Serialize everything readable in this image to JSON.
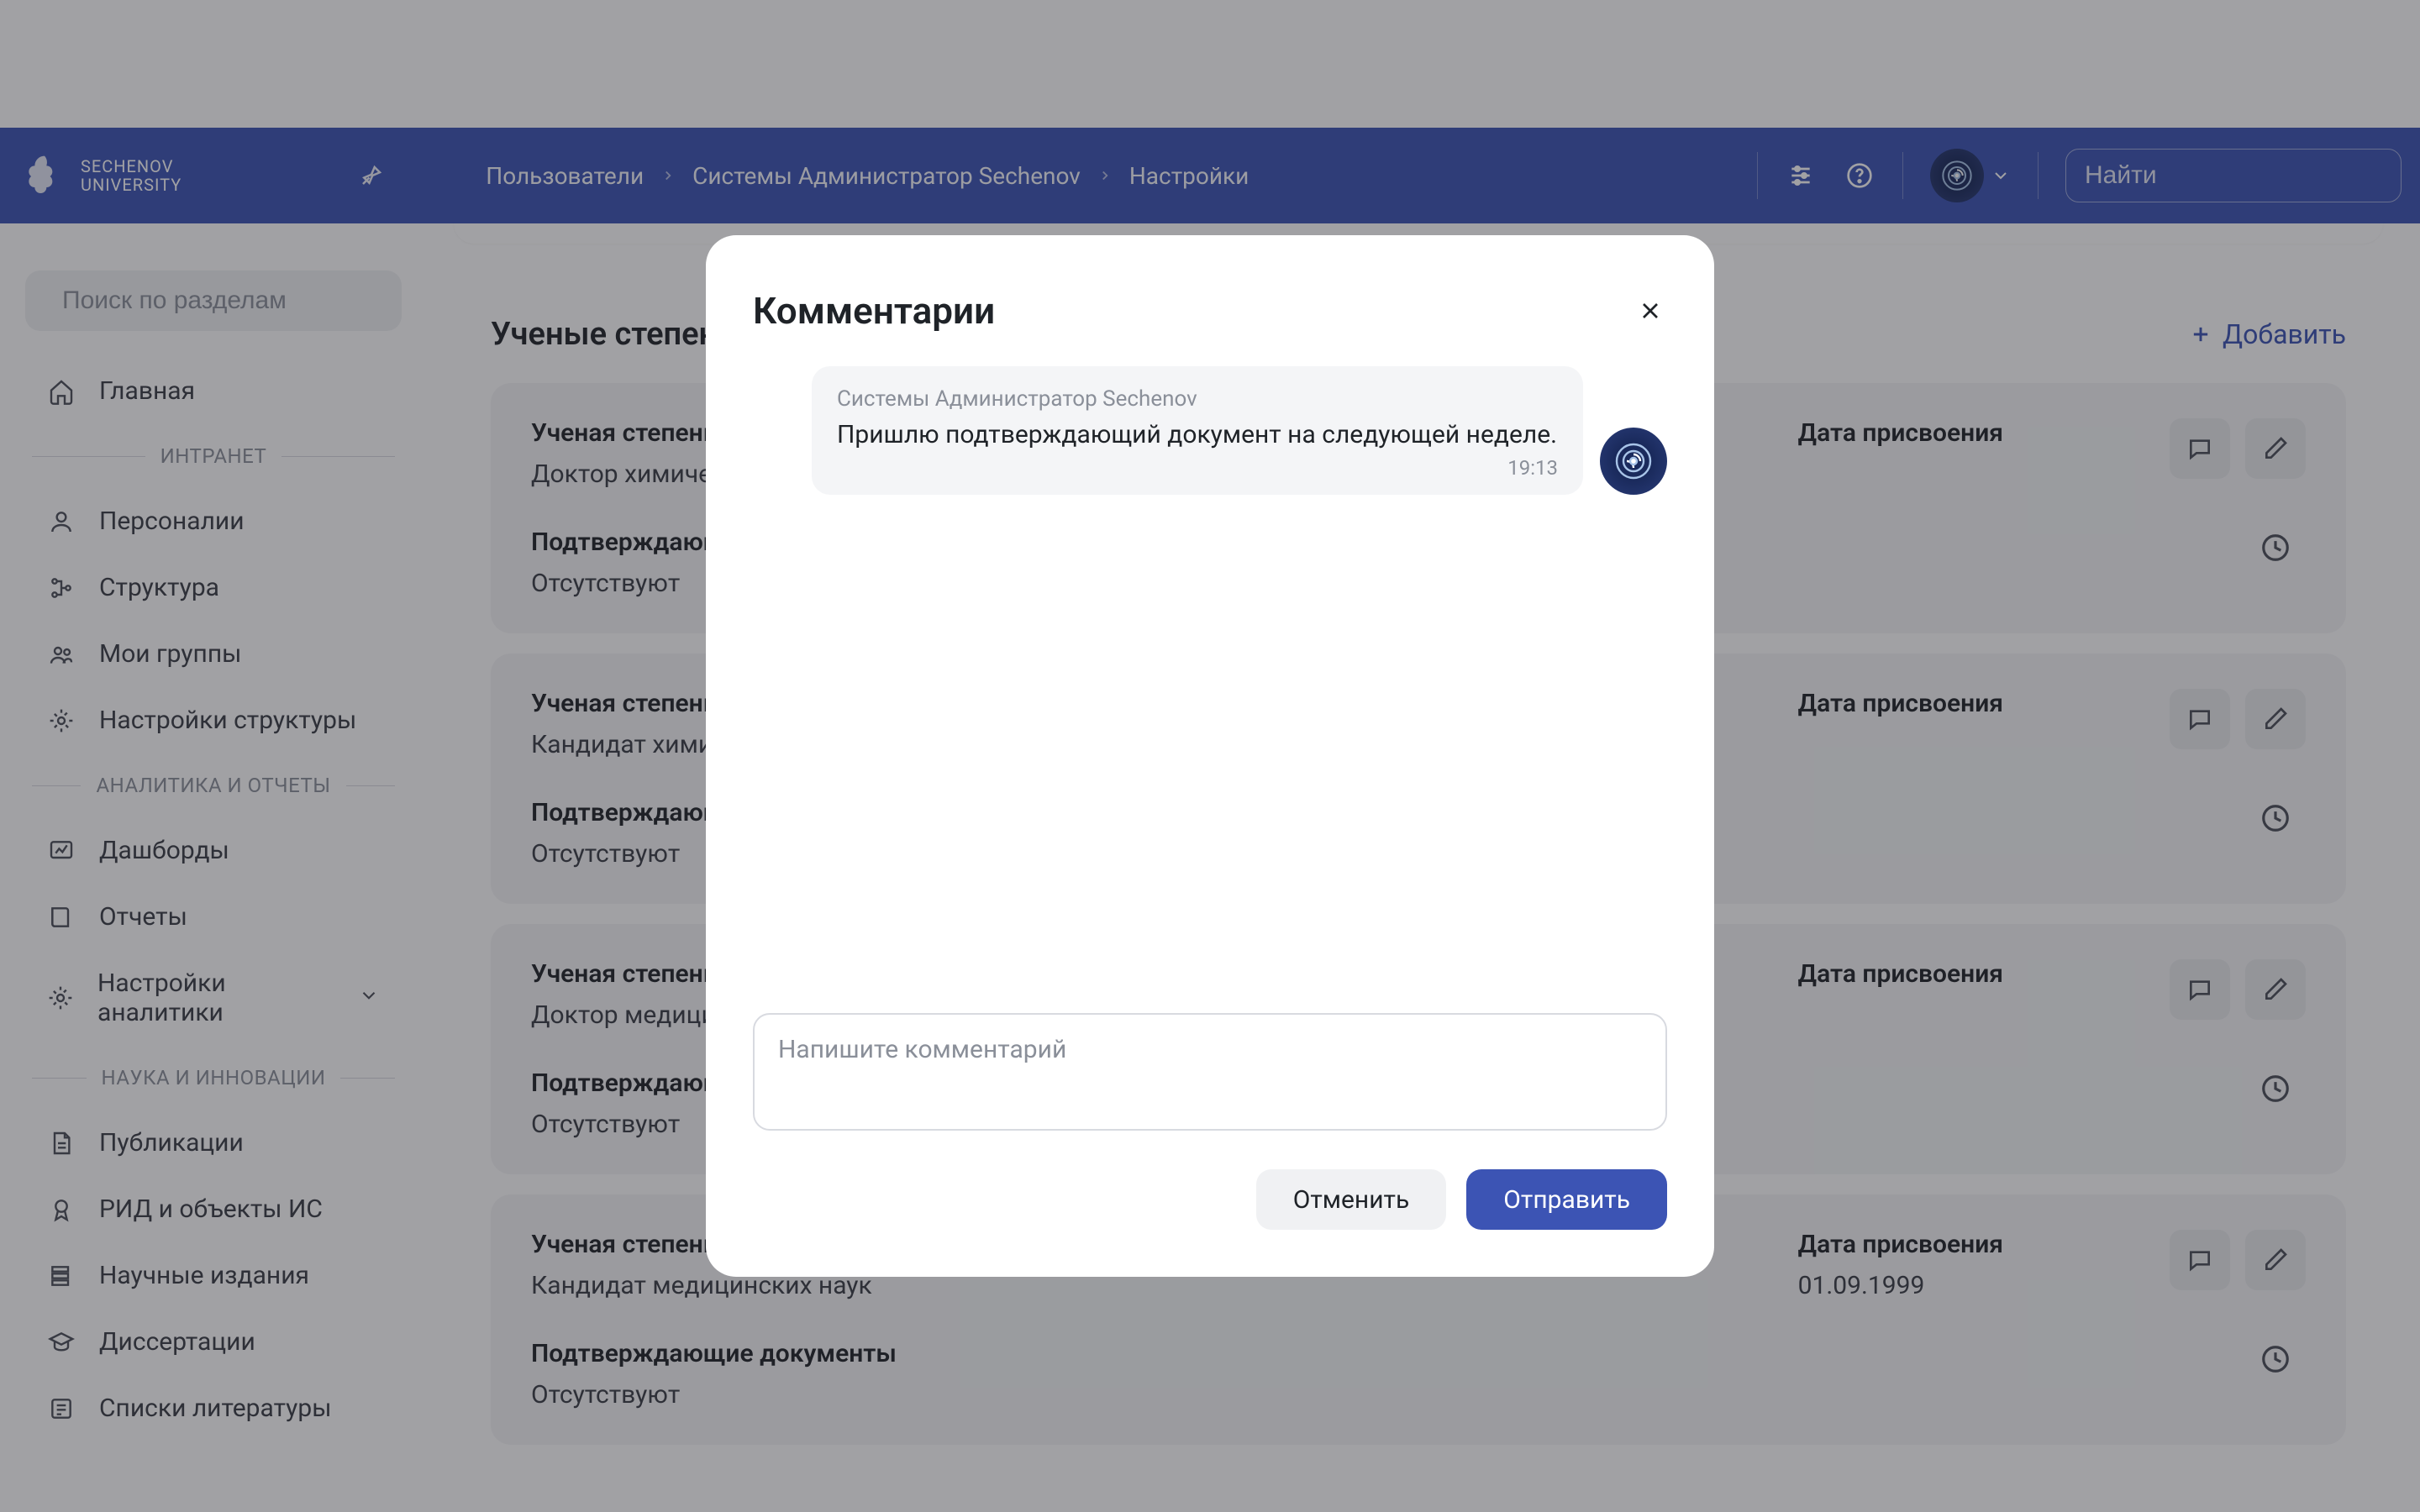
{
  "header": {
    "brand_line1": "SECHENOV",
    "brand_line2": "UNIVERSITY",
    "breadcrumb": [
      "Пользователи",
      "Системы Администратор Sechenov",
      "Настройки"
    ],
    "search_placeholder": "Найти"
  },
  "sidebar": {
    "search_placeholder": "Поиск по разделам",
    "top": [
      {
        "icon": "home",
        "label": "Главная"
      }
    ],
    "sections": [
      {
        "title": "ИНТРАНЕТ",
        "items": [
          {
            "icon": "user",
            "label": "Персоналии"
          },
          {
            "icon": "tree",
            "label": "Структура"
          },
          {
            "icon": "users",
            "label": "Мои группы"
          },
          {
            "icon": "gear",
            "label": "Настройки структуры"
          }
        ]
      },
      {
        "title": "АНАЛИТИКА И ОТЧЕТЫ",
        "items": [
          {
            "icon": "dashboard",
            "label": "Дашборды"
          },
          {
            "icon": "book",
            "label": "Отчеты"
          },
          {
            "icon": "gear",
            "label": "Настройки аналитики",
            "has_caret": true
          }
        ]
      },
      {
        "title": "НАУКА И ИННОВАЦИИ",
        "items": [
          {
            "icon": "doc",
            "label": "Публикации"
          },
          {
            "icon": "badge",
            "label": "РИД и объекты ИС"
          },
          {
            "icon": "layers",
            "label": "Научные издания"
          },
          {
            "icon": "grad",
            "label": "Диссертации"
          },
          {
            "icon": "list",
            "label": "Списки литературы"
          }
        ]
      }
    ]
  },
  "panel": {
    "title": "Ученые степени",
    "add_label": "Добавить",
    "cards": [
      {
        "degree_label": "Ученая степень",
        "degree_value": "Доктор химических наук",
        "date_label": "Дата присвоения",
        "date_value": "",
        "docs_label": "Подтверждающие документы",
        "docs_value": "Отсутствуют"
      },
      {
        "degree_label": "Ученая степень",
        "degree_value": "Кандидат химических наук",
        "date_label": "Дата присвоения",
        "date_value": "",
        "docs_label": "Подтверждающие документы",
        "docs_value": "Отсутствуют"
      },
      {
        "degree_label": "Ученая степень",
        "degree_value": "Доктор медицинских наук",
        "date_label": "Дата присвоения",
        "date_value": "",
        "docs_label": "Подтверждающие документы",
        "docs_value": "Отсутствуют"
      },
      {
        "degree_label": "Ученая степень",
        "degree_value": "Кандидат медицинских наук",
        "date_label": "Дата присвоения",
        "date_value": "01.09.1999",
        "docs_label": "Подтверждающие документы",
        "docs_value": "Отсутствуют"
      }
    ]
  },
  "modal": {
    "title": "Комментарии",
    "comment": {
      "author": "Системы Администратор Sechenov",
      "text": "Пришлю подтверждающий документ на следующей неделе.",
      "time": "19:13"
    },
    "input_placeholder": "Напишите комментарий",
    "cancel_label": "Отменить",
    "submit_label": "Отправить"
  }
}
